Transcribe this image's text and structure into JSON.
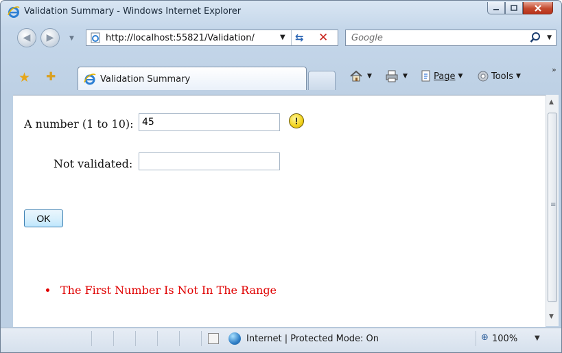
{
  "window": {
    "title": "Validation Summary - Windows Internet Explorer"
  },
  "address": {
    "url": "http://localhost:55821/Validation/"
  },
  "search": {
    "placeholder": "Google"
  },
  "tab": {
    "title": "Validation Summary"
  },
  "commands": {
    "page_label": "Page",
    "tools_label": "Tools"
  },
  "form": {
    "number_label": "A number (1 to 10):",
    "number_value": "45",
    "notvalidated_label": "Not validated:",
    "notvalidated_value": "",
    "ok_label": "OK"
  },
  "validation_summary": {
    "errors": [
      "The First Number Is Not In The Range"
    ]
  },
  "status": {
    "zone_text": "Internet | Protected Mode: On",
    "zoom": "100%"
  },
  "colors": {
    "error": "#e00000",
    "accent": "#2d67b5"
  }
}
